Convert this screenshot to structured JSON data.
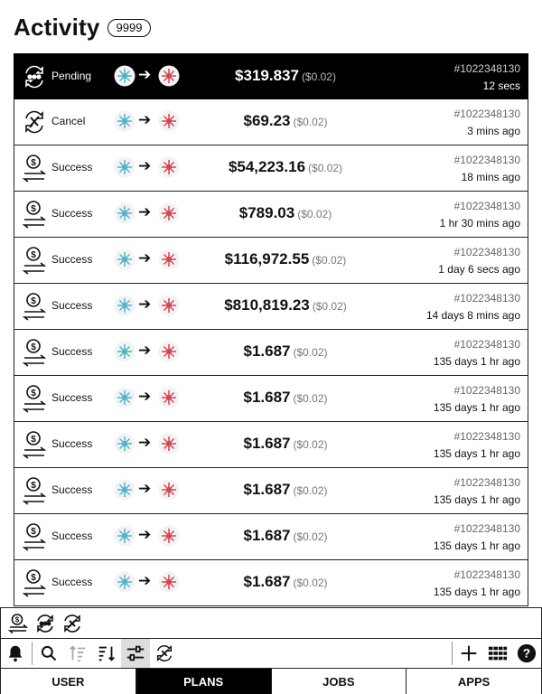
{
  "header": {
    "title": "Activity",
    "count": "9999"
  },
  "rows": [
    {
      "status": "Pending",
      "icon": "pending-icon",
      "amount": "$319.837",
      "fee": "($0.02)",
      "tx_id": "#1022348130",
      "time": "12 secs",
      "active": true
    },
    {
      "status": "Cancel",
      "icon": "cancel-icon",
      "amount": "$69.23",
      "fee": "($0.02)",
      "tx_id": "#1022348130",
      "time": "3 mins ago"
    },
    {
      "status": "Success",
      "icon": "success-icon",
      "amount": "$54,223.16",
      "fee": "($0.02)",
      "tx_id": "#1022348130",
      "time": "18 mins ago"
    },
    {
      "status": "Success",
      "icon": "success-icon",
      "amount": "$789.03",
      "fee": "($0.02)",
      "tx_id": "#1022348130",
      "time": "1 hr 30 mins ago"
    },
    {
      "status": "Success",
      "icon": "success-icon",
      "amount": "$116,972.55",
      "fee": "($0.02)",
      "tx_id": "#1022348130",
      "time": "1 day 6 secs ago"
    },
    {
      "status": "Success",
      "icon": "success-icon",
      "amount": "$810,819.23",
      "fee": "($0.02)",
      "tx_id": "#1022348130",
      "time": "14 days 8 mins ago"
    },
    {
      "status": "Success",
      "icon": "success-icon",
      "amount": "$1.687",
      "fee": "($0.02)",
      "tx_id": "#1022348130",
      "time": "135 days 1 hr ago"
    },
    {
      "status": "Success",
      "icon": "success-icon",
      "amount": "$1.687",
      "fee": "($0.02)",
      "tx_id": "#1022348130",
      "time": "135 days 1 hr ago"
    },
    {
      "status": "Success",
      "icon": "success-icon",
      "amount": "$1.687",
      "fee": "($0.02)",
      "tx_id": "#1022348130",
      "time": "135 days 1 hr ago"
    },
    {
      "status": "Success",
      "icon": "success-icon",
      "amount": "$1.687",
      "fee": "($0.02)",
      "tx_id": "#1022348130",
      "time": "135 days 1 hr ago"
    },
    {
      "status": "Success",
      "icon": "success-icon",
      "amount": "$1.687",
      "fee": "($0.02)",
      "tx_id": "#1022348130",
      "time": "135 days 1 hr ago"
    },
    {
      "status": "Success",
      "icon": "success-icon",
      "amount": "$1.687",
      "fee": "($0.02)",
      "tx_id": "#1022348130",
      "time": "135 days 1 hr ago"
    }
  ],
  "tokens": {
    "from_color": "#4fb3c9",
    "to_color": "#d9434f"
  },
  "filter_bar": {
    "icons": [
      "success-filter-icon",
      "pending-filter-icon",
      "cancel-filter-icon"
    ]
  },
  "toolbar": {
    "left_icons": [
      "bell-icon",
      "search-icon",
      "sort-asc-icon",
      "sort-desc-icon",
      "sliders-icon",
      "cancel-filter-icon"
    ],
    "right_icons": [
      "plus-icon",
      "grid-icon",
      "help-icon"
    ],
    "active": "sliders-icon"
  },
  "tabs": [
    {
      "label": "USER",
      "selected": false
    },
    {
      "label": "PLANS",
      "selected": true
    },
    {
      "label": "JOBS",
      "selected": false
    },
    {
      "label": "APPS",
      "selected": false
    }
  ]
}
